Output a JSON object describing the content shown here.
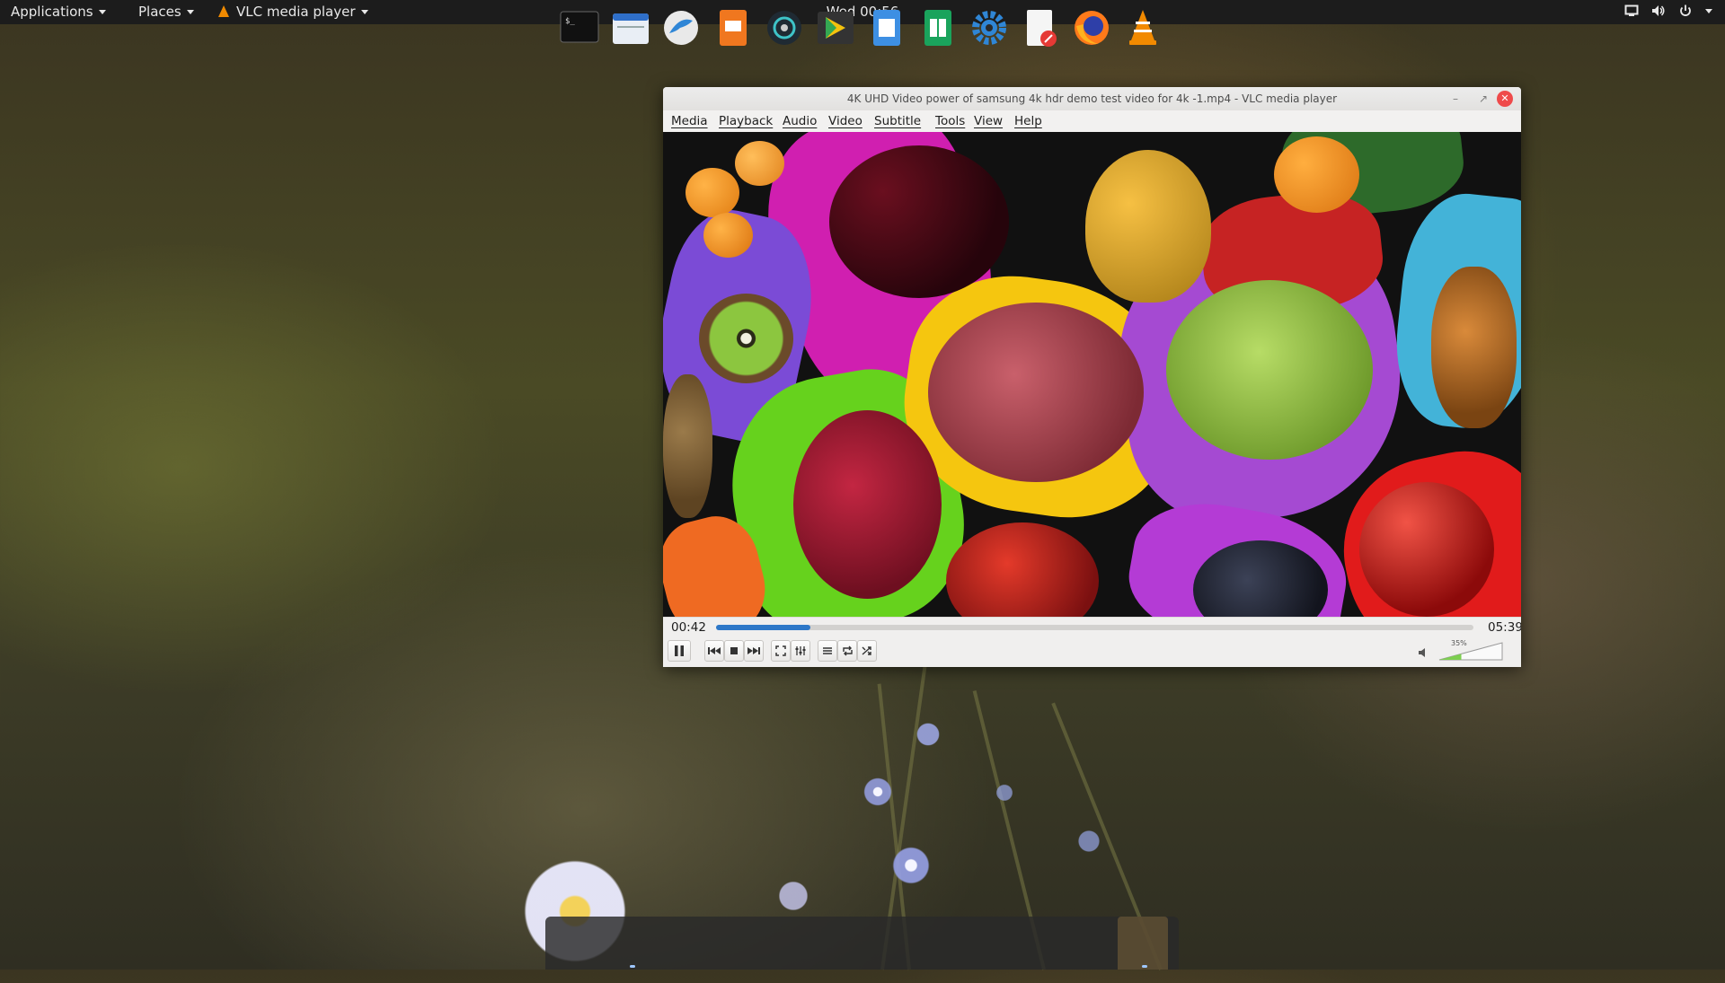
{
  "top_panel": {
    "applications_label": "Applications",
    "places_label": "Places",
    "active_app_label": "VLC media player",
    "clock": "Wed 00:56",
    "tray_icons": [
      "display-icon",
      "volume-icon",
      "power-icon"
    ]
  },
  "vlc": {
    "window_title": "4K UHD Video power of samsung 4k hdr demo test video for 4k -1.mp4 - VLC media player",
    "menu": [
      "Media",
      "Playback",
      "Audio",
      "Video",
      "Subtitle",
      "Tools",
      "View",
      "Help"
    ],
    "elapsed": "00:42",
    "duration": "05:39",
    "progress_fraction": 0.124,
    "volume_label": "35%",
    "volume_fraction": 0.35,
    "accent_color": "#2e78c8"
  },
  "dock": {
    "apps": [
      "terminal-icon",
      "files-icon",
      "browser-bird-icon",
      "presentation-icon",
      "media-disc-icon",
      "play-store-icon",
      "document-icon",
      "spreadsheet-icon",
      "settings-gear-icon",
      "text-editor-icon",
      "firefox-icon",
      "vlc-icon"
    ]
  }
}
